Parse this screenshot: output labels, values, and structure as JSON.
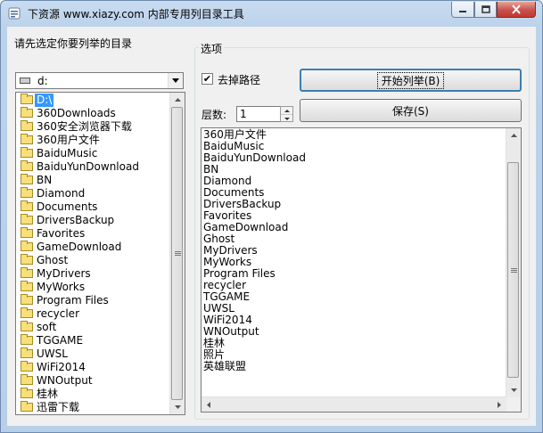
{
  "window": {
    "title": "下资源 www.xiazy.com 内部专用列目录工具"
  },
  "left": {
    "prompt_label": "请先选定你要列举的目录",
    "drive": {
      "value": "d:"
    },
    "dir_list": {
      "selected": "D:\\",
      "items": [
        "360Downloads",
        "360安全浏览器下载",
        "360用户文件",
        "BaiduMusic",
        "BaiduYunDownload",
        "BN",
        "Diamond",
        "Documents",
        "DriversBackup",
        "Favorites",
        "GameDownload",
        "Ghost",
        "MyDrivers",
        "MyWorks",
        "Program Files",
        "recycler",
        "soft",
        "TGGAME",
        "UWSL",
        "WiFi2014",
        "WNOutput",
        "桂林",
        "迅雷下载"
      ]
    }
  },
  "options": {
    "group_title": "选项",
    "strip_path_label": "去掉路径",
    "strip_path_checked": true,
    "start_button": "开始列举(B)",
    "save_button": "保存(S)",
    "depth_label": "层数:",
    "depth_value": "1"
  },
  "output": {
    "lines": [
      "360用户文件",
      "BaiduMusic",
      "BaiduYunDownload",
      "BN",
      "Diamond",
      "Documents",
      "DriversBackup",
      "Favorites",
      "GameDownload",
      "Ghost",
      "MyDrivers",
      "MyWorks",
      "Program Files",
      "recycler",
      "TGGAME",
      "UWSL",
      "WiFi2014",
      "WNOutput",
      "桂林",
      "照片",
      "英雄联盟"
    ]
  },
  "icons": {
    "app": "app-icon",
    "minimize": "minimize-icon",
    "maximize": "maximize-icon",
    "close": "close-icon",
    "drive": "drive-icon",
    "folder": "folder-icon",
    "open_folder": "open-folder-icon"
  }
}
